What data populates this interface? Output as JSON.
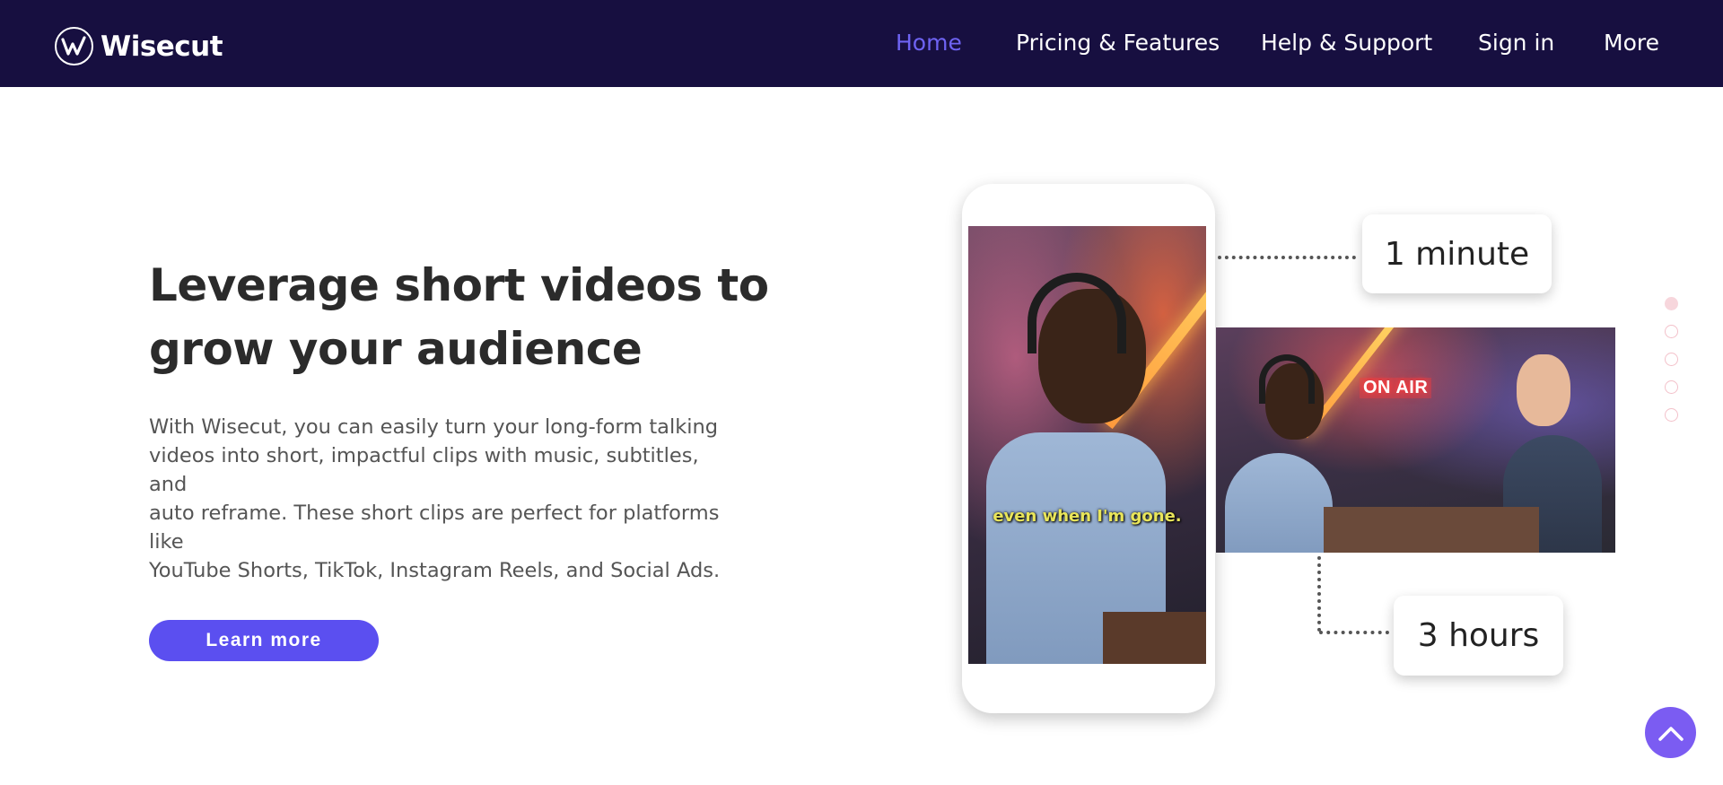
{
  "header": {
    "brand": "Wisecut",
    "nav": [
      {
        "label": "Home",
        "active": true
      },
      {
        "label": "Pricing & Features",
        "active": false
      },
      {
        "label": "Help & Support",
        "active": false
      },
      {
        "label": "Sign in",
        "active": false
      },
      {
        "label": "More",
        "active": false
      }
    ]
  },
  "hero": {
    "headline_line1": "Leverage short videos to",
    "headline_line2": "grow your audience",
    "description_lines": [
      "With Wisecut, you can easily turn your long-form talking",
      "videos into short, impactful clips with music, subtitles, and",
      "auto reframe. These short clips are perfect for platforms like",
      "YouTube Shorts, TikTok, Instagram Reels, and Social Ads."
    ],
    "cta_label": "Learn more"
  },
  "illustration": {
    "short_clip_subtitle": "even when I'm gone.",
    "studio_sign": "ON AIR",
    "short_duration": "1 minute",
    "long_duration": "3 hours"
  },
  "carousel": {
    "slide_count": 5,
    "active_index": 0
  },
  "colors": {
    "header_bg": "#170f40",
    "accent": "#5b4ff0",
    "nav_active": "#6e63f2",
    "back_to_top": "#7b5cf2"
  },
  "icons": {
    "logo": "wisecut-logo-icon",
    "back_to_top": "chevron-up-icon"
  }
}
